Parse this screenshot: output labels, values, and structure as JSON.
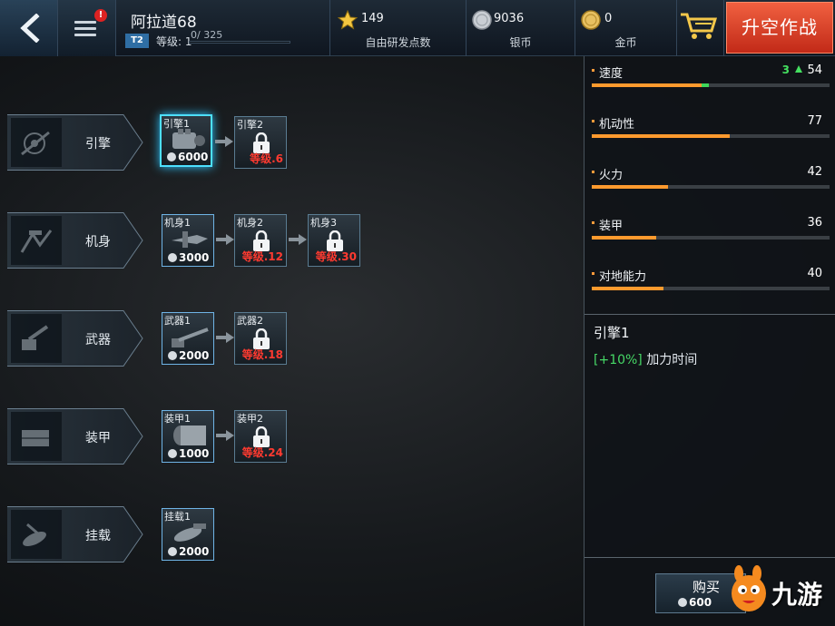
{
  "header": {
    "player_name": "阿拉道68",
    "tier": "T2",
    "level_label": "等级: 1",
    "xp": "0/ 325",
    "notification_badge": "!",
    "research_points": {
      "value": "149",
      "label": "自由研发点数"
    },
    "silver": {
      "value": "9036",
      "label": "银币"
    },
    "gold": {
      "value": "0",
      "label": "金币"
    },
    "launch_label": "升空作战"
  },
  "categories": [
    {
      "label": "引擎",
      "icon": "engine-icon",
      "modules": [
        {
          "name": "引擎1",
          "price": "6000",
          "locked": false,
          "selected": true
        },
        {
          "name": "引擎2",
          "req": "等级.6",
          "locked": true
        }
      ]
    },
    {
      "label": "机身",
      "icon": "airframe-icon",
      "modules": [
        {
          "name": "机身1",
          "price": "3000",
          "locked": false
        },
        {
          "name": "机身2",
          "req": "等级.12",
          "locked": true
        },
        {
          "name": "机身3",
          "req": "等级.30",
          "locked": true
        }
      ]
    },
    {
      "label": "武器",
      "icon": "weapon-icon",
      "modules": [
        {
          "name": "武器1",
          "price": "2000",
          "locked": false
        },
        {
          "name": "武器2",
          "req": "等级.18",
          "locked": true
        }
      ]
    },
    {
      "label": "装甲",
      "icon": "armor-icon",
      "modules": [
        {
          "name": "装甲1",
          "price": "1000",
          "locked": false
        },
        {
          "name": "装甲2",
          "req": "等级.24",
          "locked": true
        }
      ]
    },
    {
      "label": "挂载",
      "icon": "payload-icon",
      "modules": [
        {
          "name": "挂载1",
          "price": "2000",
          "locked": false
        }
      ]
    }
  ],
  "stats": [
    {
      "name": "速度",
      "value": "54",
      "bonus": "3",
      "fill": 0.46,
      "gain": 0.03
    },
    {
      "name": "机动性",
      "value": "77",
      "fill": 0.58
    },
    {
      "name": "火力",
      "value": "42",
      "fill": 0.32
    },
    {
      "name": "装甲",
      "value": "36",
      "fill": 0.27
    },
    {
      "name": "对地能力",
      "value": "40",
      "fill": 0.3
    }
  ],
  "selected_module": {
    "title": "引擎1",
    "effect_pct": "[+10%]",
    "effect_text": "加力时间"
  },
  "buy": {
    "label": "购买",
    "price": "600"
  },
  "watermark": {
    "text": "九游"
  },
  "colors": {
    "accent_orange": "#ff9a2e",
    "bonus_green": "#44e060",
    "locked_red": "#ff3a30",
    "selected_cyan": "#4de0ff",
    "launch_red": "#e04028"
  }
}
